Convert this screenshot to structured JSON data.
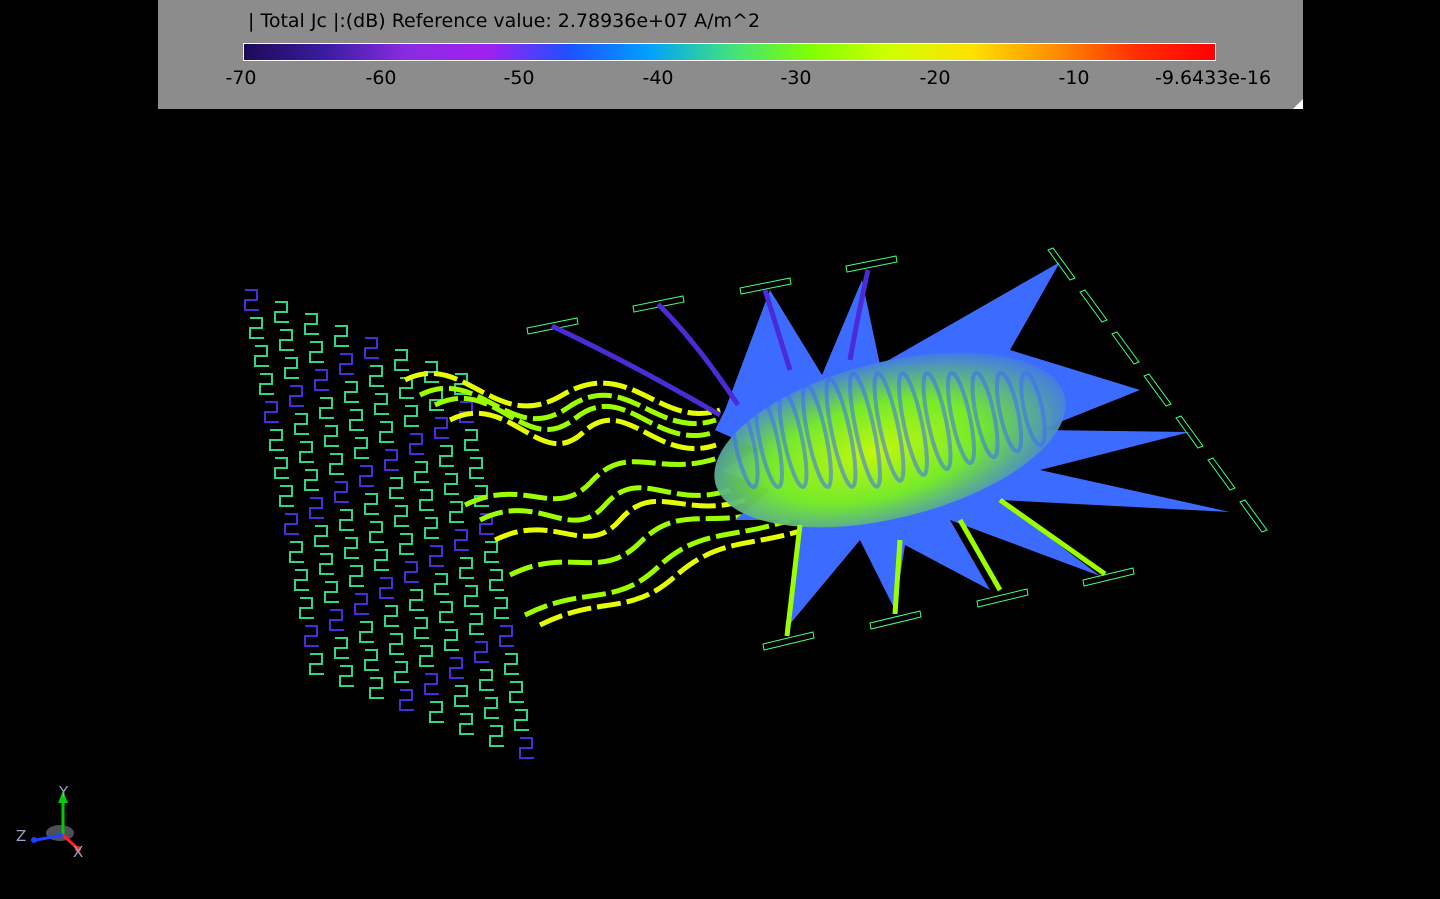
{
  "legend": {
    "title": "| Total Jc |:(dB) Reference value: 2.78936e+07 A/m^2",
    "colormap": [
      "#1c0a5a",
      "#3a1ca0",
      "#8a2be2",
      "#a020f0",
      "#1e50ff",
      "#00a0ff",
      "#40e080",
      "#80ff00",
      "#d0ff00",
      "#ffe000",
      "#ff9000",
      "#ff3000",
      "#ff0000"
    ],
    "ticks": [
      "-70",
      "-60",
      "-50",
      "-40",
      "-30",
      "-20",
      "-10",
      "-9.6433e-16"
    ]
  },
  "axes": {
    "y_label": "Y",
    "z_label": "Z",
    "x_label": "X",
    "y_color": "#00cc00",
    "x_color": "#ff2020",
    "z_color": "#2040ff"
  },
  "scene": {
    "field_colors": {
      "low": "#4b2bd6",
      "mid": "#3c6cff",
      "high": "#9cff00",
      "peak": "#e6ff00",
      "trace": "#2fd68a",
      "port_outline": "#40ff80"
    }
  }
}
